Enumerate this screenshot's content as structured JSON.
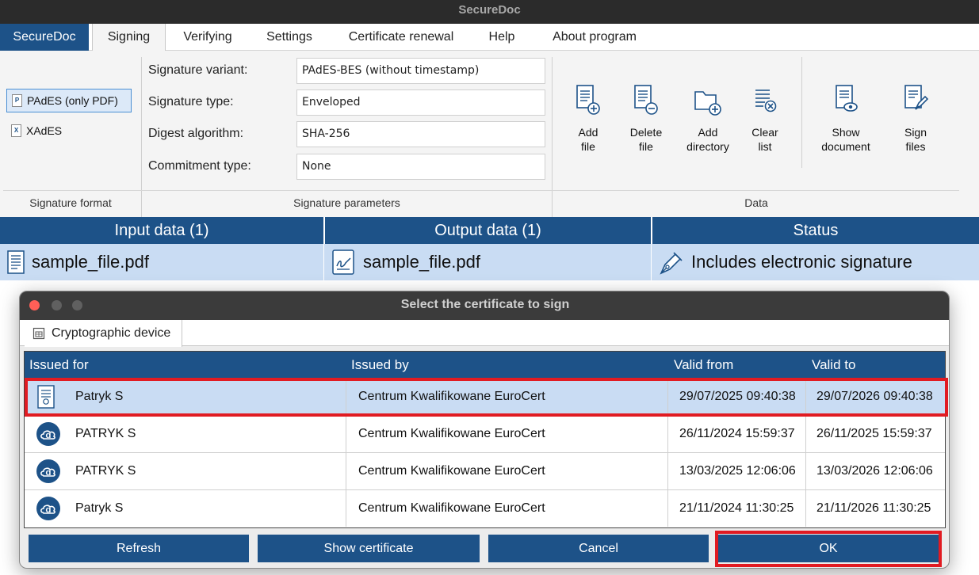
{
  "window": {
    "title": "SecureDoc"
  },
  "menu": {
    "brand": "SecureDoc",
    "tabs": [
      "Signing",
      "Verifying",
      "Settings",
      "Certificate renewal",
      "Help",
      "About program"
    ],
    "active_tab": "Signing"
  },
  "ribbon": {
    "signature_format": {
      "label": "Signature format",
      "options": [
        {
          "label": "PAdES (only PDF)",
          "icon": "pdf-file-icon",
          "selected": true
        },
        {
          "label": "XAdES",
          "icon": "xml-file-icon",
          "selected": false
        }
      ]
    },
    "signature_parameters": {
      "label": "Signature parameters",
      "fields": [
        {
          "label": "Signature variant:",
          "value": "PAdES-BES (without timestamp)"
        },
        {
          "label": "Signature type:",
          "value": "Enveloped"
        },
        {
          "label": "Digest algorithm:",
          "value": "SHA-256"
        },
        {
          "label": "Commitment type:",
          "value": "None"
        }
      ]
    },
    "data": {
      "label": "Data",
      "buttons": [
        {
          "line1": "Add",
          "line2": "file",
          "icon": "add-file-icon"
        },
        {
          "line1": "Delete",
          "line2": "file",
          "icon": "delete-file-icon"
        },
        {
          "line1": "Add",
          "line2": "directory",
          "icon": "add-directory-icon"
        },
        {
          "line1": "Clear",
          "line2": "list",
          "icon": "clear-list-icon"
        },
        {
          "line1": "Show",
          "line2": "document",
          "icon": "show-document-icon"
        },
        {
          "line1": "Sign",
          "line2": "files",
          "icon": "sign-files-icon"
        }
      ]
    }
  },
  "file_table": {
    "headers": [
      "Input data (1)",
      "Output data (1)",
      "Status"
    ],
    "rows": [
      {
        "input": "sample_file.pdf",
        "output": "sample_file.pdf",
        "status": "Includes electronic signature"
      }
    ]
  },
  "dialog": {
    "title": "Select the certificate to sign",
    "tab": "Cryptographic device",
    "columns": [
      "Issued for",
      "Issued by",
      "Valid from",
      "Valid to"
    ],
    "rows": [
      {
        "issued_for": "Patryk S",
        "issued_by": "Centrum Kwalifikowane EuroCert",
        "valid_from": "29/07/2025 09:40:38",
        "valid_to": "29/07/2026 09:40:38",
        "icon": "certificate-document-icon",
        "selected": true
      },
      {
        "issued_for": "PATRYK S",
        "issued_by": "Centrum Kwalifikowane EuroCert",
        "valid_from": "26/11/2024 15:59:37",
        "valid_to": "26/11/2025 15:59:37",
        "icon": "cloud-certificate-icon",
        "selected": false
      },
      {
        "issued_for": "PATRYK S",
        "issued_by": "Centrum Kwalifikowane EuroCert",
        "valid_from": "13/03/2025 12:06:06",
        "valid_to": "13/03/2026 12:06:06",
        "icon": "cloud-certificate-icon",
        "selected": false
      },
      {
        "issued_for": "Patryk S",
        "issued_by": "Centrum Kwalifikowane EuroCert",
        "valid_from": "21/11/2024 11:30:25",
        "valid_to": "21/11/2026 11:30:25",
        "icon": "cloud-certificate-icon",
        "selected": false
      }
    ],
    "buttons": [
      "Refresh",
      "Show certificate",
      "Cancel",
      "OK"
    ]
  },
  "colors": {
    "brand_blue": "#1d5288",
    "selection": "#c9dcf3",
    "highlight_red": "#e11b22"
  }
}
